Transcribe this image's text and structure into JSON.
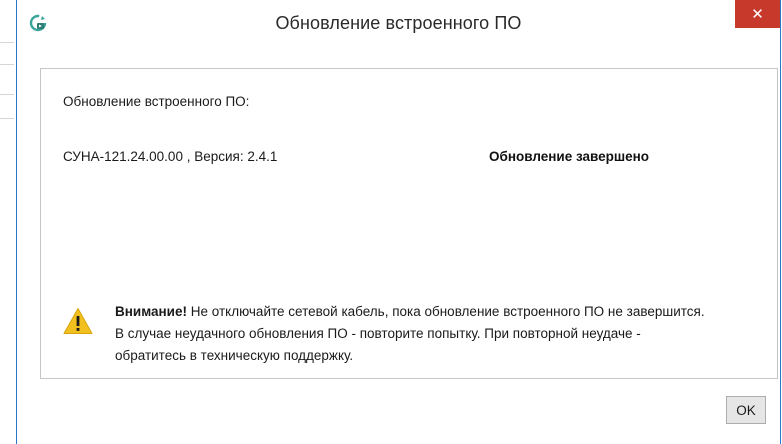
{
  "window": {
    "title": "Обновление встроенного ПО",
    "close_glyph": "✕",
    "icon": "app-update-icon"
  },
  "panel": {
    "heading": "Обновление встроенного ПО:",
    "device": "СУНА-121.24.00.00 , Версия: 2.4.1",
    "status": "Обновление завершено"
  },
  "warning": {
    "icon": "warning-icon",
    "label": "Внимание!",
    "message": " Не отключайте сетевой кабель, пока обновление встроенного ПО не завершится. В случае неудачного обновления ПО - повторите попытку. При повторной неудаче - обратитесь в техническую поддержку."
  },
  "buttons": {
    "ok": "OK"
  },
  "colors": {
    "close_button": "#c7392b",
    "window_border": "#2b78c9",
    "warning_fill": "#f2c01e",
    "icon_teal": "#3aa39a"
  }
}
